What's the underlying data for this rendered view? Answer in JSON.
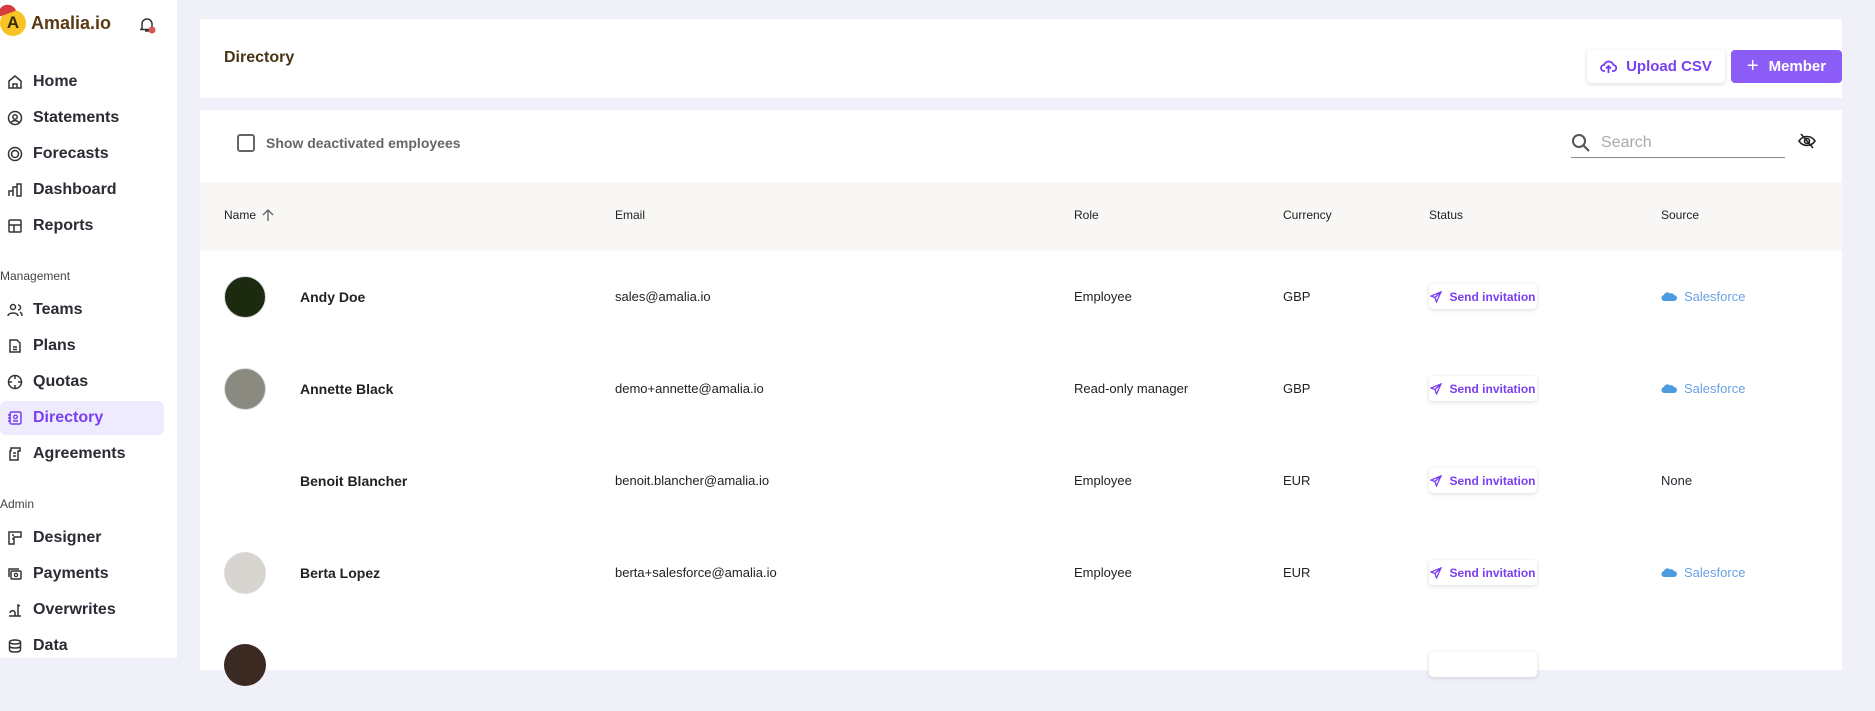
{
  "app": {
    "name": "Amalia.io"
  },
  "sidebar": {
    "main": [
      {
        "label": "Home",
        "icon": "home-icon"
      },
      {
        "label": "Statements",
        "icon": "user-circle-icon"
      },
      {
        "label": "Forecasts",
        "icon": "forecast-icon"
      },
      {
        "label": "Dashboard",
        "icon": "bar-chart-icon"
      },
      {
        "label": "Reports",
        "icon": "table-icon"
      }
    ],
    "management_label": "Management",
    "management": [
      {
        "label": "Teams",
        "icon": "users-icon"
      },
      {
        "label": "Plans",
        "icon": "file-icon"
      },
      {
        "label": "Quotas",
        "icon": "target-icon"
      },
      {
        "label": "Directory",
        "icon": "address-book-icon",
        "active": true
      },
      {
        "label": "Agreements",
        "icon": "contract-icon"
      }
    ],
    "admin_label": "Admin",
    "admin": [
      {
        "label": "Designer",
        "icon": "designer-icon"
      },
      {
        "label": "Payments",
        "icon": "payments-icon"
      },
      {
        "label": "Overwrites",
        "icon": "overwrite-icon"
      },
      {
        "label": "Data",
        "icon": "database-icon"
      }
    ]
  },
  "header": {
    "title": "Directory",
    "upload_label": "Upload CSV",
    "member_label": "Member"
  },
  "filters": {
    "show_deactivated_label": "Show deactivated employees",
    "show_deactivated": false,
    "search_placeholder": "Search"
  },
  "table": {
    "columns": [
      "Name",
      "Email",
      "Role",
      "Currency",
      "Status",
      "Source"
    ],
    "rows": [
      {
        "name": "Andy Doe",
        "email": "sales@amalia.io",
        "role": "Employee",
        "currency": "GBP",
        "status": "Send invitation",
        "source": "Salesforce",
        "avatar_color": "#1c2a10"
      },
      {
        "name": "Annette Black",
        "email": "demo+annette@amalia.io",
        "role": "Read-only manager",
        "currency": "GBP",
        "status": "Send invitation",
        "source": "Salesforce",
        "avatar_color": "#8a8a80"
      },
      {
        "name": "Benoit Blancher",
        "email": "benoit.blancher@amalia.io",
        "role": "Employee",
        "currency": "EUR",
        "status": "Send invitation",
        "source": "None",
        "avatar_color": "#ffffff"
      },
      {
        "name": "Berta Lopez",
        "email": "berta+salesforce@amalia.io",
        "role": "Employee",
        "currency": "EUR",
        "status": "Send invitation",
        "source": "Salesforce",
        "avatar_color": "#d8d4d0"
      }
    ]
  },
  "colors": {
    "accent": "#8b5cf6",
    "salesforce": "#6aa2e3"
  }
}
